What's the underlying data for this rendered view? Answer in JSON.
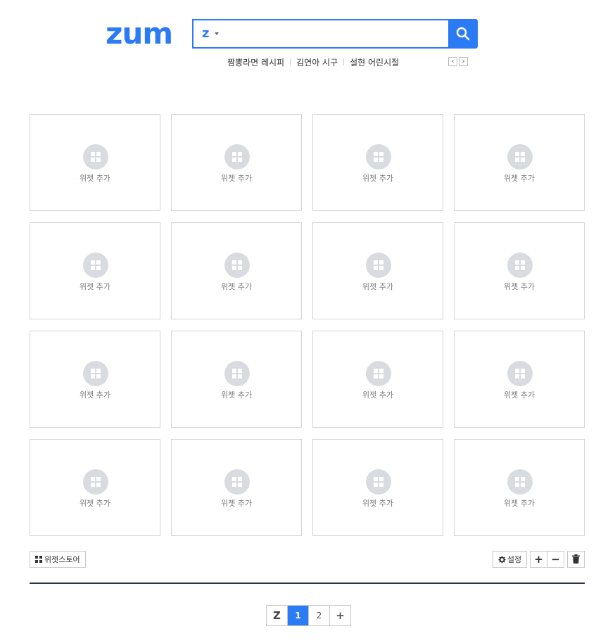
{
  "header": {
    "logo_text": "zum",
    "search": {
      "engine_icon": "z",
      "value": "",
      "placeholder": "",
      "button_icon": "search-icon"
    },
    "keywords": [
      "짬뽕라면 레시피",
      "김연아 시구",
      "설현 어린시절"
    ],
    "prev_icon": "‹",
    "next_icon": "›"
  },
  "widgets": {
    "tile_label": "위젯 추가",
    "count": 16
  },
  "toolbar": {
    "store_label": "위젯스토어",
    "settings_label": "설정",
    "add_label": "+",
    "remove_label": "−"
  },
  "pager": {
    "home_label": "Z",
    "pages": [
      "1",
      "2"
    ],
    "active_page": "1",
    "add_label": "+"
  },
  "colors": {
    "brand": "#2b7bf5",
    "divider": "#2c3442",
    "icon_circle": "#d8dbe0"
  }
}
